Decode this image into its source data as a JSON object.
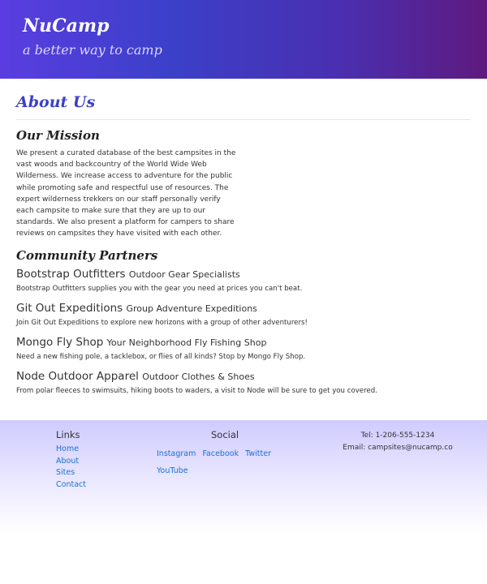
{
  "header": {
    "brand": "NuCamp",
    "tagline": "a better way to camp"
  },
  "about": {
    "title": "About Us",
    "mission_heading": "Our Mission",
    "mission_text": "We present a curated database of the best campsites in the vast woods and backcountry of the World Wide Web Wilderness. We increase access to adventure for the public while promoting safe and respectful use of resources. The expert wilderness trekkers on our staff personally verify each campsite to make sure that they are up to our standards. We also present a platform for campers to share reviews on campsites they have visited with each other.",
    "partners_heading": "Community Partners",
    "partners": [
      {
        "name": "Bootstrap Outfitters",
        "tag": "Outdoor Gear Specialists",
        "desc": "Bootstrap Outfitters supplies you with the gear you need at prices you can't beat."
      },
      {
        "name": "Git Out Expeditions",
        "tag": "Group Adventure Expeditions",
        "desc": "Join Git Out Expeditions to explore new horizons with a group of other adventurers!"
      },
      {
        "name": "Mongo Fly Shop",
        "tag": "Your Neighborhood Fly Fishing Shop",
        "desc": "Need a new fishing pole, a tacklebox, or flies of all kinds? Stop by Mongo Fly Shop."
      },
      {
        "name": "Node Outdoor Apparel",
        "tag": "Outdoor Clothes & Shoes",
        "desc": "From polar fleeces to swimsuits, hiking boots to waders, a visit to Node will be sure to get you covered."
      }
    ]
  },
  "footer": {
    "links_heading": "Links",
    "links": [
      "Home",
      "About",
      "Sites",
      "Contact"
    ],
    "social_heading": "Social",
    "social": [
      "Instagram",
      "Facebook",
      "Twitter",
      "YouTube"
    ],
    "tel": "Tel: 1-206-555-1234",
    "email": "Email: campsites@nucamp.co"
  }
}
